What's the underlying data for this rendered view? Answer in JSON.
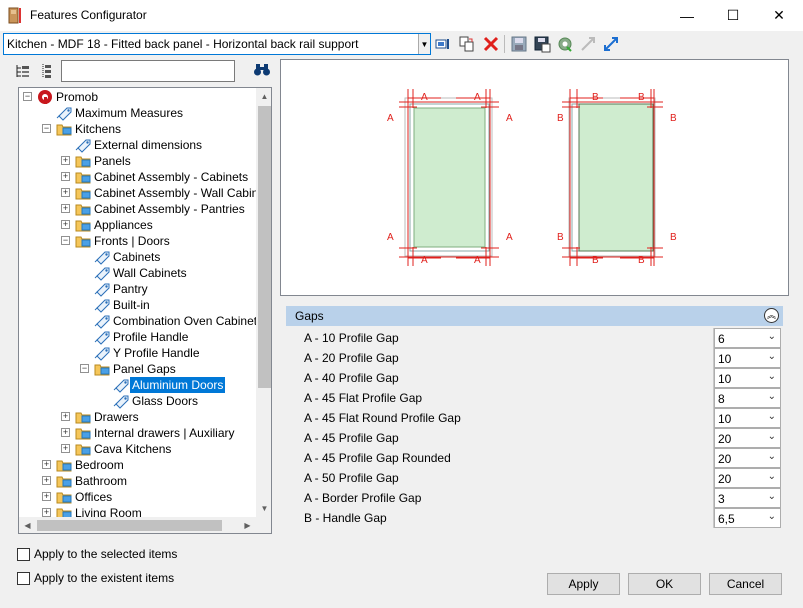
{
  "window": {
    "title": "Features Configurator",
    "minimize": "—",
    "maximize": "☐",
    "close": "✕"
  },
  "toolbar": {
    "config_value": "Kitchen - MDF 18 - Fitted back panel - Horizontal back rail support"
  },
  "tree": {
    "search_value": "",
    "items": [
      {
        "label": "Promob",
        "icon": "promob-logo-icon"
      },
      {
        "label": "Maximum Measures",
        "icon": "tag-icon"
      },
      {
        "label": "Kitchens",
        "icon": "folder-icon"
      },
      {
        "label": "External dimensions",
        "icon": "tag-icon"
      },
      {
        "label": "Panels",
        "icon": "folder-icon"
      },
      {
        "label": "Cabinet Assembly - Cabinets",
        "icon": "folder-icon"
      },
      {
        "label": "Cabinet Assembly - Wall Cabinets",
        "icon": "folder-icon"
      },
      {
        "label": "Cabinet Assembly - Pantries",
        "icon": "folder-icon"
      },
      {
        "label": "Appliances",
        "icon": "folder-icon"
      },
      {
        "label": "Fronts | Doors",
        "icon": "folder-icon"
      },
      {
        "label": "Cabinets",
        "icon": "tag-icon"
      },
      {
        "label": "Wall Cabinets",
        "icon": "tag-icon"
      },
      {
        "label": "Pantry",
        "icon": "tag-icon"
      },
      {
        "label": "Built-in",
        "icon": "tag-icon"
      },
      {
        "label": "Combination Oven Cabinets",
        "icon": "tag-icon"
      },
      {
        "label": "Profile Handle",
        "icon": "tag-icon"
      },
      {
        "label": "Y Profile Handle",
        "icon": "tag-icon"
      },
      {
        "label": "Panel Gaps",
        "icon": "folder-icon"
      },
      {
        "label": "Aluminium Doors",
        "icon": "tag-icon"
      },
      {
        "label": "Glass Doors",
        "icon": "tag-icon"
      },
      {
        "label": "Drawers",
        "icon": "folder-icon"
      },
      {
        "label": "Internal drawers | Auxiliary",
        "icon": "folder-icon"
      },
      {
        "label": "Cava Kitchens",
        "icon": "folder-icon"
      },
      {
        "label": "Bedroom",
        "icon": "folder-icon"
      },
      {
        "label": "Bathroom",
        "icon": "folder-icon"
      },
      {
        "label": "Offices",
        "icon": "folder-icon"
      },
      {
        "label": "Living Room",
        "icon": "folder-icon"
      }
    ]
  },
  "preview": {
    "left_labels": [
      "A",
      "A",
      "A",
      "A",
      "A",
      "A",
      "A",
      "A"
    ],
    "right_labels": [
      "B",
      "B",
      "B",
      "B",
      "B",
      "B",
      "B",
      "B"
    ]
  },
  "gaps": {
    "title": "Gaps",
    "rows": [
      {
        "name": "A - 10 Profile Gap",
        "value": "6"
      },
      {
        "name": "A - 20 Profile Gap",
        "value": "10"
      },
      {
        "name": "A - 40 Profile Gap",
        "value": "10"
      },
      {
        "name": "A - 45 Flat Profile Gap",
        "value": "8"
      },
      {
        "name": "A - 45 Flat Round Profile Gap",
        "value": "10"
      },
      {
        "name": "A - 45 Profile Gap",
        "value": "20"
      },
      {
        "name": "A - 45 Profile Gap Rounded",
        "value": "20"
      },
      {
        "name": "A - 50 Profile Gap",
        "value": "20"
      },
      {
        "name": "A - Border Profile Gap",
        "value": "3"
      },
      {
        "name": "B - Handle Gap",
        "value": "6,5"
      }
    ]
  },
  "options": {
    "apply_selected": "Apply to the selected items",
    "apply_existent": "Apply to the existent items"
  },
  "buttons": {
    "apply": "Apply",
    "ok": "OK",
    "cancel": "Cancel"
  },
  "colors": {
    "accent": "#0078d7",
    "dim_red": "#e0201c",
    "panel_green": "#cfeccf",
    "gaps_header": "#b9d1ea"
  }
}
